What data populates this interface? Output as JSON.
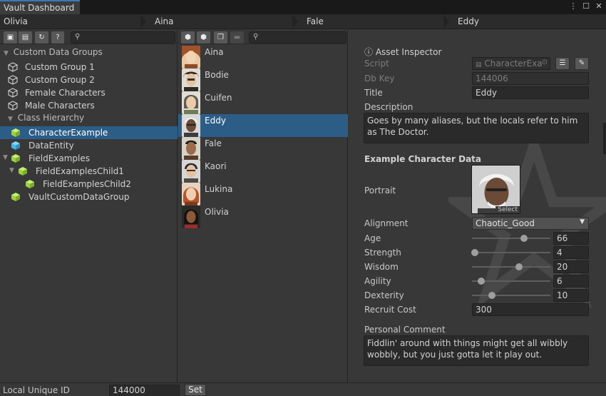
{
  "window": {
    "tab_title": "Vault Dashboard",
    "menu_icon": "kebab-menu-icon",
    "maximize_icon": "maximize-icon",
    "close_icon": "close-icon"
  },
  "breadcrumbs": [
    "Olivia",
    "Aina",
    "Fale",
    "Eddy"
  ],
  "left_panel": {
    "toolbar_icons": [
      "add-data-group-icon",
      "remove-data-group-icon",
      "refresh-icon",
      "help-icon"
    ],
    "search_placeholder": "",
    "groups_heading": "Custom Data Groups",
    "groups": [
      "Custom Group 1",
      "Custom Group 2",
      "Female Characters",
      "Male Characters"
    ],
    "hierarchy_heading": "Class Hierarchy",
    "hierarchy": [
      {
        "label": "CharacterExample",
        "selected": true,
        "color": "#9bd13f"
      },
      {
        "label": "DataEntity",
        "selected": false,
        "color": "#4ab7e8"
      },
      {
        "label": "FieldExamples",
        "selected": false,
        "color": "#9bd13f"
      },
      {
        "label": "FieldExamplesChild1",
        "selected": false,
        "color": "#9bd13f"
      },
      {
        "label": "FieldExamplesChild2",
        "selected": false,
        "color": "#9bd13f"
      },
      {
        "label": "VaultCustomDataGroup",
        "selected": false,
        "color": "#9bd13f"
      }
    ]
  },
  "middle_panel": {
    "toolbar_icons": [
      "add-entity-icon",
      "duplicate-entity-icon",
      "copy-icon",
      "delete-entity-icon"
    ],
    "search_placeholder": "",
    "items": [
      {
        "name": "Aina",
        "selected": false
      },
      {
        "name": "Bodie",
        "selected": false
      },
      {
        "name": "Cuifen",
        "selected": false
      },
      {
        "name": "Eddy",
        "selected": true
      },
      {
        "name": "Fale",
        "selected": false
      },
      {
        "name": "Kaori",
        "selected": false
      },
      {
        "name": "Lukina",
        "selected": false
      },
      {
        "name": "Olivia",
        "selected": false
      }
    ]
  },
  "inspector": {
    "title": "ⓘ Asset Inspector",
    "script_label": "Script",
    "script_value": "CharacterExa",
    "dbkey_label": "Db Key",
    "dbkey_value": "144006",
    "title_label": "Title",
    "title_value": "Eddy",
    "description_label": "Description",
    "description_value": "Goes by many aliases, but the locals refer to him as The Doctor.",
    "section_heading": "Example Character Data",
    "portrait_label": "Portrait",
    "portrait_select": "Select",
    "alignment_label": "Alignment",
    "alignment_value": "Chaotic_Good",
    "stats": [
      {
        "label": "Age",
        "value": "66",
        "fraction": 0.66
      },
      {
        "label": "Strength",
        "value": "4",
        "fraction": 0.04
      },
      {
        "label": "Wisdom",
        "value": "20",
        "fraction": 0.6
      },
      {
        "label": "Agility",
        "value": "6",
        "fraction": 0.12
      },
      {
        "label": "Dexterity",
        "value": "10",
        "fraction": 0.25
      }
    ],
    "recruit_label": "Recruit Cost",
    "recruit_value": "300",
    "comment_label": "Personal Comment",
    "comment_value": "Fiddlin' around with things might get all wibbly wobbly, but you just gotta let it play out."
  },
  "bottom": {
    "label": "Local Unique ID",
    "value": "144000",
    "button": "Set"
  }
}
